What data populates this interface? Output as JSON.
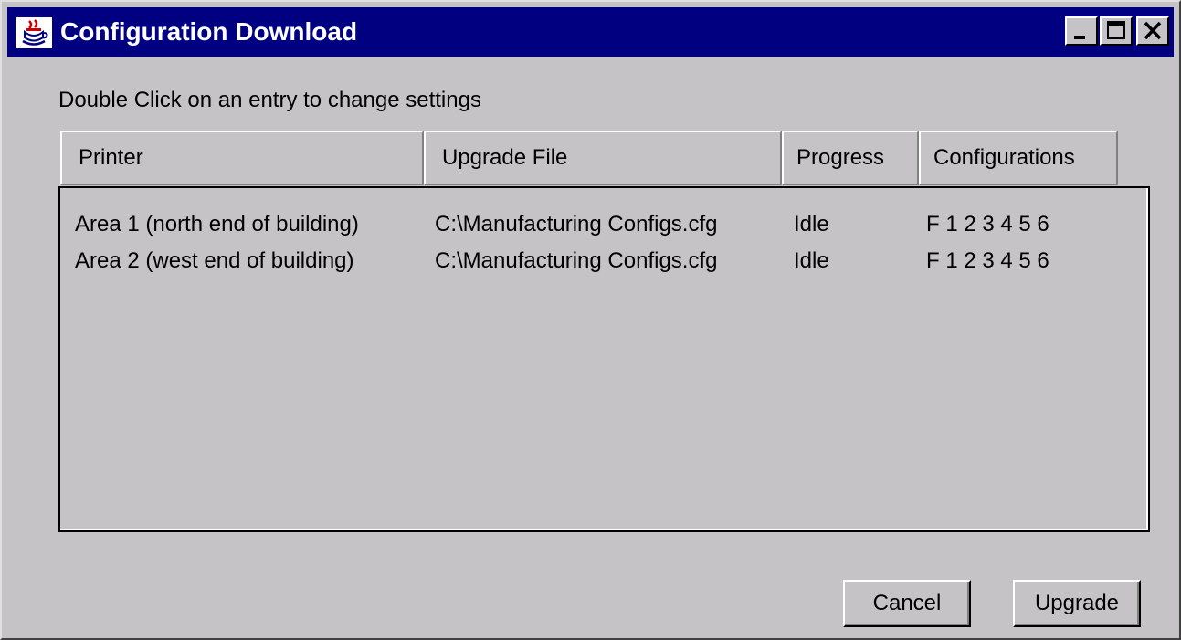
{
  "window": {
    "title": "Configuration Download",
    "titlebar_color": "#000080",
    "icon": "app-java-cup-icon"
  },
  "titlebar_buttons": {
    "minimize_icon": "minimize-icon",
    "maximize_icon": "maximize-icon",
    "close_icon": "close-icon"
  },
  "instruction": "Double Click on an entry to change settings",
  "table": {
    "columns": [
      "Printer",
      "Upgrade File",
      "Progress",
      "Configurations"
    ],
    "rows": [
      {
        "printer": "Area 1 (north end of building)",
        "upgrade_file": "C:\\Manufacturing Configs.cfg",
        "progress": "Idle",
        "configurations": "F 1 2 3 4 5 6"
      },
      {
        "printer": "Area 2 (west end of building)",
        "upgrade_file": "C:\\Manufacturing Configs.cfg",
        "progress": "Idle",
        "configurations": "F 1 2 3 4 5 6"
      }
    ]
  },
  "buttons": {
    "cancel": "Cancel",
    "upgrade": "Upgrade"
  }
}
